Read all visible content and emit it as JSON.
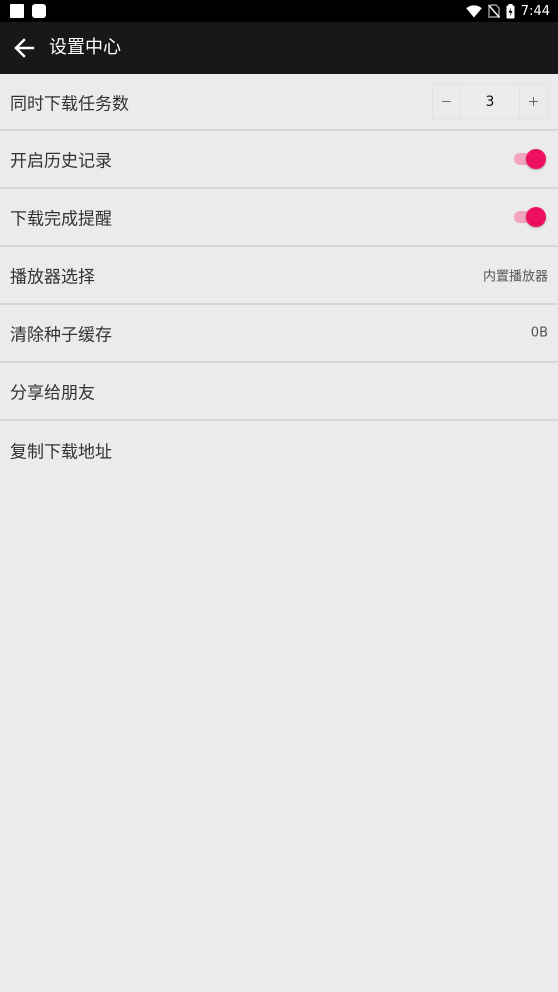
{
  "status_bar": {
    "time": "7:44",
    "icons": [
      "notification-square-icon",
      "notification-rounded-icon",
      "wifi-icon",
      "no-sim-icon",
      "battery-charging-icon"
    ]
  },
  "app_bar": {
    "back_icon": "arrow-left-icon",
    "title": "设置中心"
  },
  "settings": {
    "concurrent_downloads": {
      "label": "同时下载任务数",
      "value": "3",
      "minus": "－",
      "plus": "＋"
    },
    "history": {
      "label": "开启历史记录",
      "enabled": true
    },
    "download_reminder": {
      "label": "下载完成提醒",
      "enabled": true
    },
    "player": {
      "label": "播放器选择",
      "value": "内置播放器"
    },
    "clear_cache": {
      "label": "清除种子缓存",
      "value": "0B"
    },
    "share": {
      "label": "分享给朋友"
    },
    "copy_address": {
      "label": "复制下载地址"
    }
  },
  "colors": {
    "app_bar": "#181818",
    "background": "#ebebeb",
    "accent": "#ef0f60",
    "accent_track": "#f2a3c0"
  }
}
